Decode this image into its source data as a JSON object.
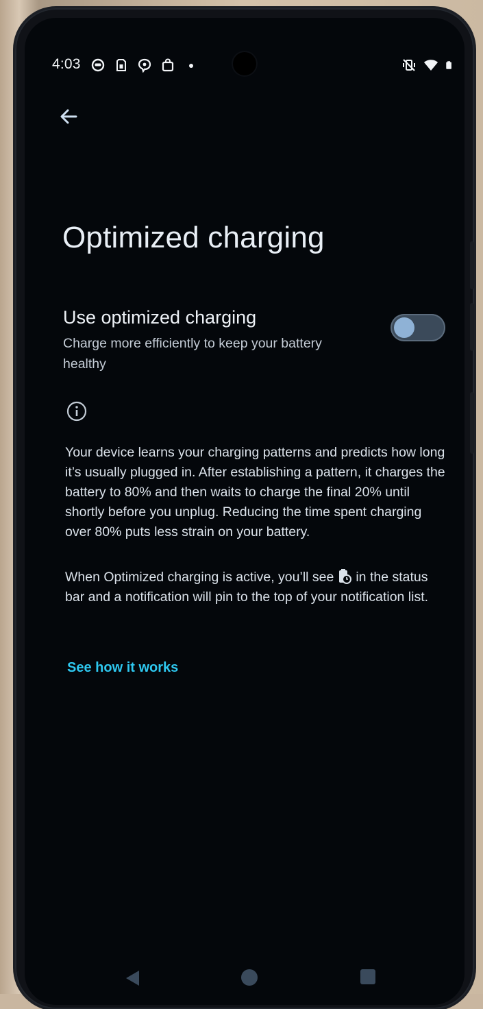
{
  "status_bar": {
    "time": "4:03",
    "left_icons": [
      "app-notification-icon",
      "sim-card-icon",
      "chat-bubble-icon",
      "shopping-bag-icon",
      "dot-icon"
    ],
    "right_icons": [
      "vibrate-muted-icon",
      "wifi-icon",
      "battery-icon"
    ]
  },
  "header": {
    "back_icon": "arrow-back-icon",
    "title": "Optimized charging"
  },
  "setting": {
    "title": "Use optimized charging",
    "subtitle": "Charge more efficiently to keep your battery healthy",
    "toggle_state": "off"
  },
  "info": {
    "icon": "info-icon",
    "paragraph1": "Your device learns your charging patterns and predicts how long it’s usually plugged in. After establishing a pattern, it charges the battery to 80% and then waits to charge the final 20% until shortly before you unplug. Reducing the time spent charging over 80% puts less strain on your battery.",
    "paragraph2_before_icon": "When Optimized charging is active, you’ll see",
    "paragraph2_icon": "battery-clock-icon",
    "paragraph2_after_icon": "in the status bar and a notification will pin to the top of your notification list."
  },
  "link": {
    "label": "See how it works"
  },
  "colors": {
    "background": "#04070b",
    "accent_link": "#2ec8f0",
    "toggle_track": "#3b4a5a",
    "toggle_thumb": "#8fb2d6"
  },
  "nav_bar": {
    "buttons": [
      "nav-back-icon",
      "nav-home-icon",
      "nav-recents-icon"
    ]
  }
}
